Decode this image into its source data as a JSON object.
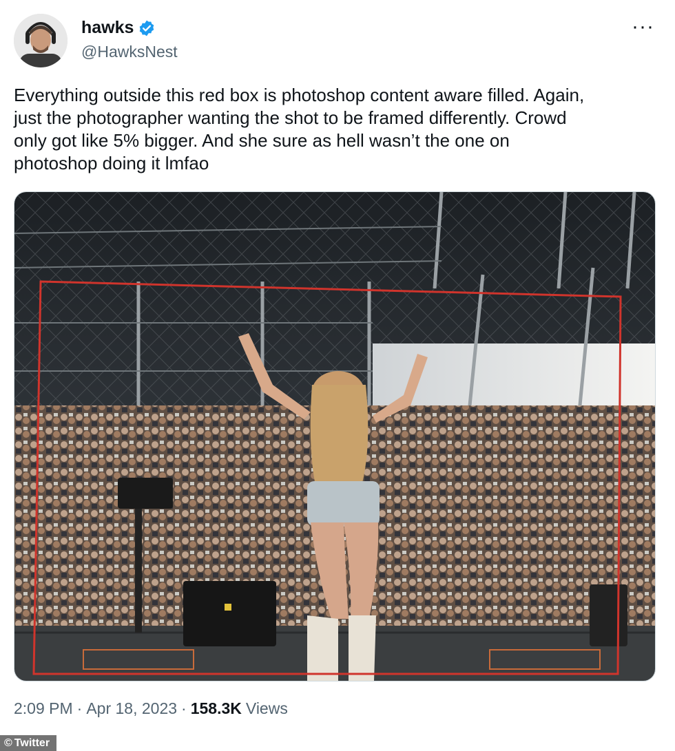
{
  "author": {
    "name": "hawks",
    "handle": "@HawksNest",
    "verified": true,
    "avatar_icon": "avatar-man-headphones"
  },
  "menu": {
    "icon": "more-horizontal-icon",
    "label": "···"
  },
  "tweet": {
    "text": "Everything outside this red box is photoshop content aware filled. Again,\njust the photographer wanting the shot to be framed differently. Crowd\nonly got like 5% bigger. And she sure as hell wasn’t the one on\nphotoshop doing it lmfao"
  },
  "media": {
    "description_icon": "concert-stage-photo",
    "highlight_color": "#d0342c"
  },
  "meta": {
    "time": "2:09 PM",
    "sep1": "·",
    "date": "Apr 18, 2023",
    "sep2": "·",
    "views_count": "158.3K",
    "views_label": "Views"
  },
  "credit": {
    "symbol": "©",
    "label": "Twitter"
  },
  "colors": {
    "accent": "#1d9bf0",
    "secondary_text": "#536471",
    "primary_text": "#0f1419"
  }
}
